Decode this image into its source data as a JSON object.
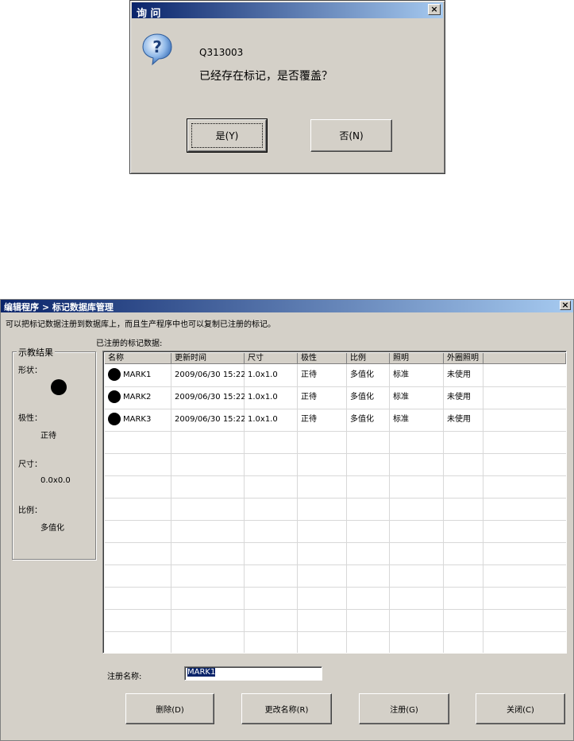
{
  "dialog": {
    "title": "询  问",
    "close_label": "×",
    "code": "Q313003",
    "message": "已经存在标记，是否覆盖？",
    "yes_label": "是(Y)",
    "no_label": "否(N)"
  },
  "main": {
    "title": "编辑程序 > 标记数据库管理",
    "close_label": "×",
    "description": "可以把标记数据注册到数据库上，而且生产程序中也可以复制已注册的标记。",
    "group_title": "示教结果",
    "shape_label": "形状：",
    "polarity_label": "极性：",
    "polarity_value": "正待",
    "size_label": "尺寸：",
    "size_value": "0.0x0.0",
    "ratio_label": "比例：",
    "ratio_value": "多值化",
    "list_label": "已注册的标记数据:",
    "columns": [
      "名称",
      "更新时间",
      "尺寸",
      "极性",
      "比例",
      "照明",
      "外圈照明"
    ],
    "rows": [
      [
        "MARK1",
        "2009/06/30 15:22",
        "1.0x1.0",
        "正待",
        "多值化",
        "标准",
        "未使用"
      ],
      [
        "MARK2",
        "2009/06/30 15:22",
        "1.0x1.0",
        "正待",
        "多值化",
        "标准",
        "未使用"
      ],
      [
        "MARK3",
        "2009/06/30 15:22",
        "1.0x1.0",
        "正待",
        "多值化",
        "标准",
        "未使用"
      ]
    ],
    "reg_name_label": "注册名称:",
    "reg_name_value": "MARK1",
    "delete_label": "删除(D)",
    "rename_label": "更改名称(R)",
    "register_label": "注册(G)",
    "close_btn_label": "关闭(C)"
  }
}
